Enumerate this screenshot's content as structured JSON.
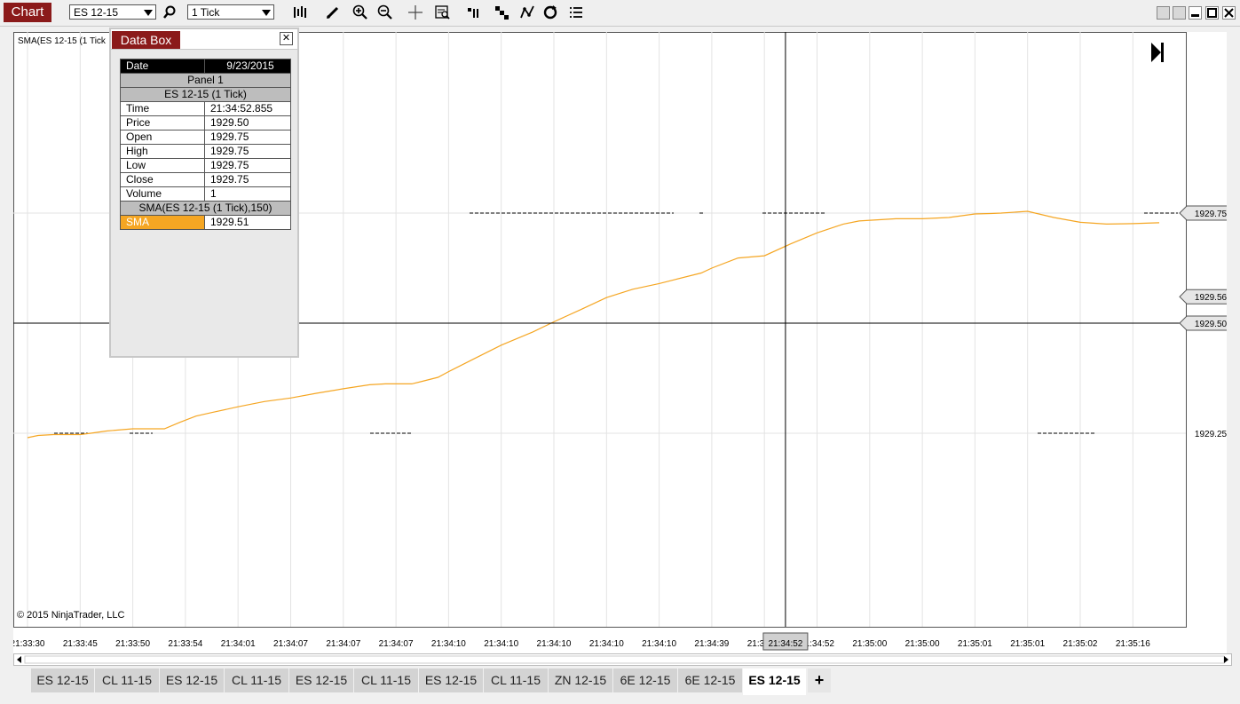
{
  "toolbar": {
    "title": "Chart",
    "instrument": "ES 12-15",
    "interval": "1 Tick"
  },
  "chart": {
    "indicator_label": "SMA(ES 12-15 (1 Tick",
    "copyright": "© 2015 NinjaTrader, LLC",
    "crosshair_time": "21:34:52.852",
    "colors": {
      "sma": "#f5a623",
      "background": "#ffffff",
      "grid": "#e3e3e3"
    }
  },
  "chart_data": {
    "type": "line",
    "title": "",
    "xlabel": "",
    "ylabel": "",
    "ylim": [
      1929.19,
      1929.81
    ],
    "x_tick_labels": [
      "21:33:30",
      "21:33:45",
      "21:33:50",
      "21:33:54",
      "21:34:01",
      "21:34:07",
      "21:34:07",
      "21:34:07",
      "21:34:10",
      "21:34:10",
      "21:34:10",
      "21:34:10",
      "21:34:10",
      "21:34:39",
      "21:34:52",
      "21:34:52",
      "21:35:00",
      "21:35:00",
      "21:35:01",
      "21:35:01",
      "21:35:02",
      "21:35:16"
    ],
    "y_tick_labels": [
      "1929.75",
      "1929.50",
      "1929.25"
    ],
    "y_ticks": [
      1929.75,
      1929.5,
      1929.25
    ],
    "price_markers": [
      {
        "value": 1929.75,
        "label": "1929.75"
      },
      {
        "value": 1929.5,
        "label": "1929.50",
        "crosshair": true
      },
      {
        "value": 1929.56,
        "label": "1929.56",
        "series": "SMA"
      }
    ],
    "crosshair": {
      "x_index": 14.4,
      "value": 1929.5
    },
    "series": [
      {
        "name": "SMA",
        "x": [
          0.0,
          0.2,
          0.5,
          1.0,
          1.2,
          1.5,
          2.0,
          2.3,
          2.6,
          2.9,
          3.2,
          3.5,
          4.0,
          4.5,
          5.0,
          5.5,
          6.0,
          6.5,
          6.8,
          7.0,
          7.3,
          7.5,
          7.8,
          8.0,
          8.5,
          9.0,
          9.6,
          10.0,
          10.5,
          11.0,
          11.5,
          12.0,
          12.3,
          12.8,
          13.0,
          13.5,
          14.0,
          14.5,
          15.0,
          15.5,
          15.8,
          16.5,
          17.0,
          17.5,
          18.0,
          18.3,
          18.5,
          19.0,
          19.5,
          20.0,
          20.5,
          21.0,
          21.5
        ],
        "y": [
          1929.24,
          1929.245,
          1929.247,
          1929.247,
          1929.25,
          1929.255,
          1929.26,
          1929.26,
          1929.26,
          1929.275,
          1929.289,
          1929.297,
          1929.31,
          1929.322,
          1929.33,
          1929.341,
          1929.351,
          1929.36,
          1929.362,
          1929.362,
          1929.362,
          1929.368,
          1929.377,
          1929.39,
          1929.42,
          1929.45,
          1929.48,
          1929.503,
          1929.53,
          1929.558,
          1929.577,
          1929.59,
          1929.599,
          1929.614,
          1929.625,
          1929.648,
          1929.653,
          1929.68,
          1929.705,
          1929.725,
          1929.732,
          1929.737,
          1929.737,
          1929.74,
          1929.748,
          1929.749,
          1929.75,
          1929.754,
          1929.74,
          1929.729,
          1929.725,
          1929.726,
          1929.728
        ]
      }
    ]
  },
  "databox": {
    "title": "Data Box",
    "date_label": "Date",
    "date_value": "9/23/2015",
    "panel": "Panel 1",
    "instrument_section": "ES 12-15 (1 Tick)",
    "rows": [
      {
        "k": "Time",
        "v": "21:34:52.855"
      },
      {
        "k": "Price",
        "v": "1929.50"
      },
      {
        "k": "Open",
        "v": "1929.75"
      },
      {
        "k": "High",
        "v": "1929.75"
      },
      {
        "k": "Low",
        "v": "1929.75"
      },
      {
        "k": "Close",
        "v": "1929.75"
      },
      {
        "k": "Volume",
        "v": "1"
      }
    ],
    "sma_section": "SMA(ES 12-15 (1 Tick),150)",
    "sma_label": "SMA",
    "sma_value": "1929.51"
  },
  "tabs": [
    {
      "label": "ES 12-15"
    },
    {
      "label": "CL 11-15"
    },
    {
      "label": "ES 12-15"
    },
    {
      "label": "CL 11-15"
    },
    {
      "label": "ES 12-15"
    },
    {
      "label": "CL 11-15"
    },
    {
      "label": "ES 12-15"
    },
    {
      "label": "CL 11-15"
    },
    {
      "label": "ZN 12-15"
    },
    {
      "label": "6E 12-15"
    },
    {
      "label": "6E 12-15"
    },
    {
      "label": "ES 12-15",
      "active": true
    }
  ],
  "tab_add": "+"
}
